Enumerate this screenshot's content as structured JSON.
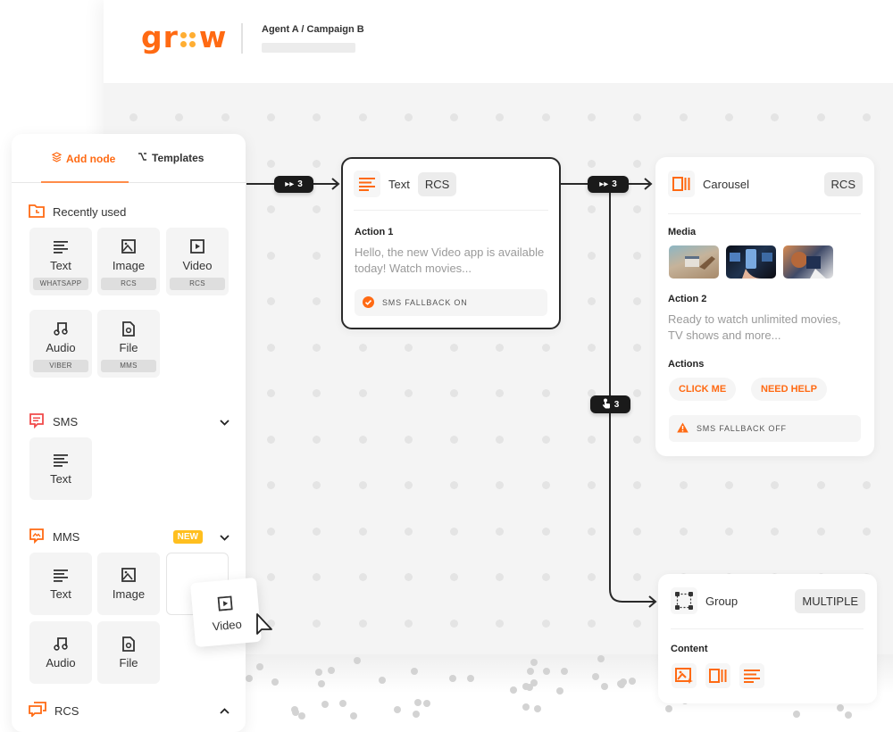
{
  "header": {
    "logo_left": "gr",
    "logo_right": "w",
    "breadcrumb": "Agent A / Campaign B"
  },
  "sidebar": {
    "tabs": [
      {
        "label": "Add node",
        "icon": "layers-icon",
        "active": true
      },
      {
        "label": "Templates",
        "icon": "branch-icon",
        "active": false
      }
    ],
    "recently_used": {
      "title": "Recently used",
      "icon": "folder-clock-icon",
      "items": [
        {
          "label": "Text",
          "tag": "WHATSAPP",
          "icon": "text-lines-icon"
        },
        {
          "label": "Image",
          "tag": "RCS",
          "icon": "image-icon"
        },
        {
          "label": "Video",
          "tag": "RCS",
          "icon": "video-icon"
        },
        {
          "label": "Audio",
          "tag": "VIBER",
          "icon": "music-icon"
        },
        {
          "label": "File",
          "tag": "MMS",
          "icon": "file-icon"
        }
      ]
    },
    "sms": {
      "title": "SMS",
      "icon": "sms-bubble-icon",
      "expanded": false,
      "items": [
        {
          "label": "Text",
          "icon": "text-lines-icon"
        }
      ]
    },
    "mms": {
      "title": "MMS",
      "badge": "NEW",
      "icon": "mms-bubble-icon",
      "expanded": false,
      "items": [
        {
          "label": "Text",
          "icon": "text-lines-icon"
        },
        {
          "label": "Image",
          "icon": "image-icon"
        },
        {
          "label": "Audio",
          "icon": "music-icon"
        },
        {
          "label": "File",
          "icon": "file-icon"
        }
      ]
    },
    "rcs": {
      "title": "RCS",
      "icon": "rcs-bubbles-icon",
      "expanded": true
    },
    "drag_ghost": {
      "label": "Video",
      "icon": "video-icon"
    }
  },
  "canvas": {
    "edges": [
      {
        "badge": "3",
        "badge_icon": "fast-forward-icon"
      },
      {
        "badge": "3",
        "badge_icon": "fast-forward-icon"
      },
      {
        "badge": "3",
        "badge_icon": "tap-hand-icon"
      }
    ],
    "nodes": {
      "text": {
        "title": "Text",
        "chip": "RCS",
        "section": "Action 1",
        "body": "Hello, the new Video app is available today! Watch movies...",
        "fallback": "SMS FALLBACK ON",
        "fallback_status": "on"
      },
      "carousel": {
        "title": "Carousel",
        "chip": "RCS",
        "media_label": "Media",
        "media_count": 3,
        "section": "Action 2",
        "body": "Ready to watch unlimited movies, TV shows and more...",
        "actions_label": "Actions",
        "actions": [
          "CLICK ME",
          "NEED HELP"
        ],
        "fallback": "SMS FALLBACK OFF",
        "fallback_status": "off"
      },
      "group": {
        "title": "Group",
        "chip": "MULTIPLE",
        "content_label": "Content",
        "content_icons": [
          "image-sparkle-icon",
          "carousel-icon",
          "text-lines-icon"
        ]
      }
    }
  },
  "colors": {
    "accent": "#ff6a13",
    "logo_dots": "#ffae33",
    "new_badge": "#ffbf1f",
    "sms_icon": "#f04a4a",
    "edge": "#2a2a2a"
  }
}
